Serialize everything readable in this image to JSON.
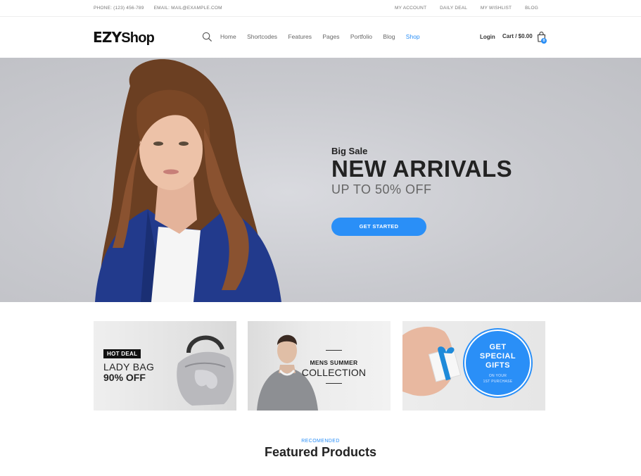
{
  "topbar": {
    "phone": "PHONE: (123) 456-789",
    "email": "EMAIL: MAIL@EXAMPLE.COM",
    "links": [
      "MY ACCOUNT",
      "DAILY DEAL",
      "MY WISHLIST",
      "BLOG"
    ]
  },
  "header": {
    "logo_a": "EZY",
    "logo_b": "Shop",
    "nav": [
      "Home",
      "Shortcodes",
      "Features",
      "Pages",
      "Portfolio",
      "Blog",
      "Shop"
    ],
    "active_nav": "Shop",
    "login": "Login",
    "cart": "Cart / $0.00",
    "cart_count": "0"
  },
  "hero": {
    "small": "Big Sale",
    "title": "NEW ARRIVALS",
    "sub": "UP TO 50% OFF",
    "button": "GET STARTED"
  },
  "promos": {
    "bag": {
      "badge": "HOT DEAL",
      "line1": "LADY BAG",
      "line2": "90% OFF"
    },
    "mens": {
      "line1": "MENS SUMMER",
      "line2": "COLLECTION"
    },
    "gifts": {
      "title1": "GET",
      "title2": "SPECIAL",
      "title3": "GIFTS",
      "sub1": "ON YOUR",
      "sub2": "1ST PURCHASE"
    }
  },
  "featured": {
    "eyebrow": "RECOMENDED",
    "title": "Featured Products"
  },
  "colors": {
    "accent": "#2a8ff7",
    "hero_bg": "#c8c9ce",
    "text": "#222222"
  }
}
